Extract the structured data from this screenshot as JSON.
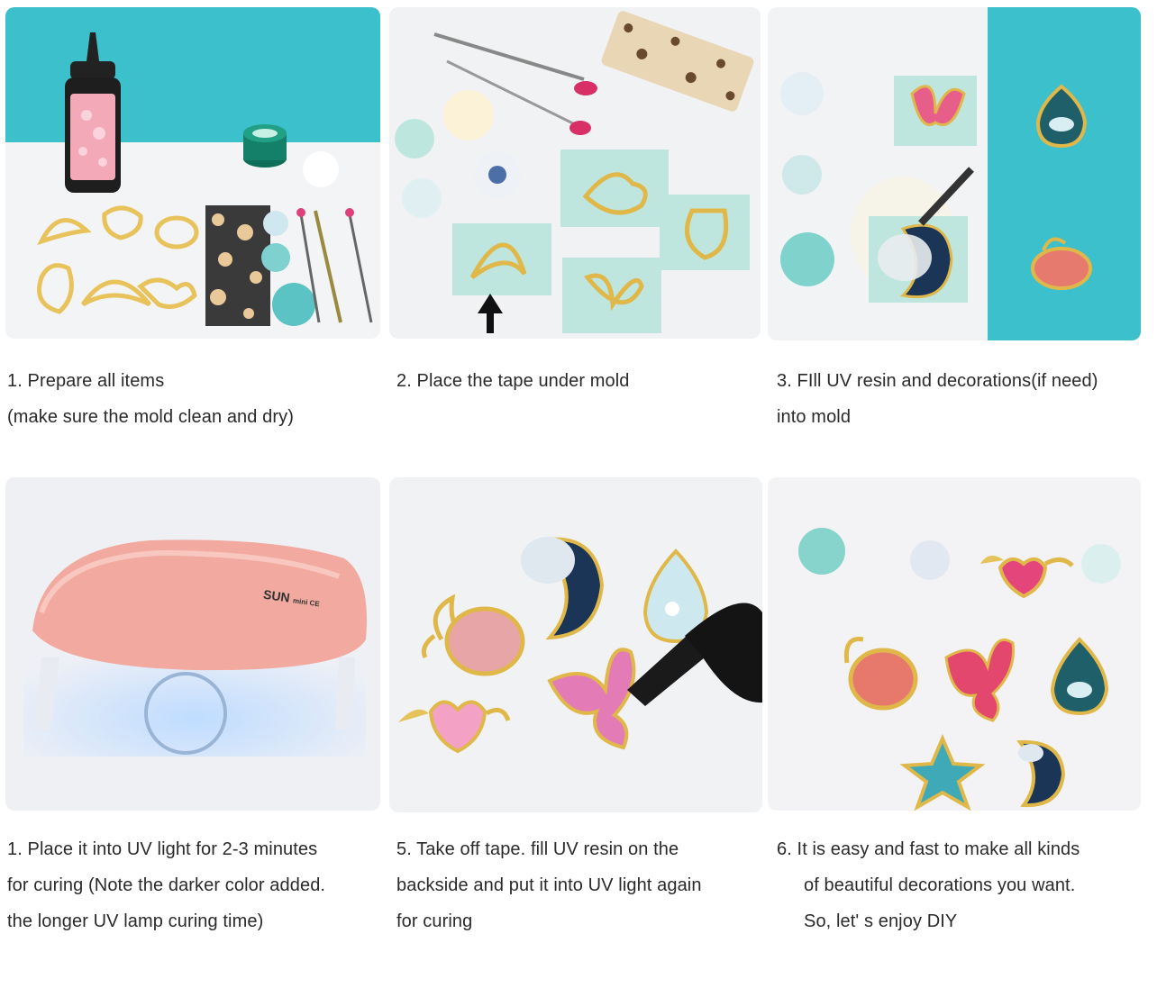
{
  "steps": [
    {
      "lines": [
        "1. Prepare all items",
        "(make sure the mold clean and dry)"
      ]
    },
    {
      "lines": [
        "2. Place the tape under mold"
      ]
    },
    {
      "lines": [
        "3. FIll UV resin and decorations(if need)",
        "into mold"
      ]
    },
    {
      "lines": [
        "1. Place it into UV light for 2-3 minutes",
        "for curing (Note the darker color added.",
        "the longer UV lamp curing time)"
      ]
    },
    {
      "lines": [
        "5. Take off tape. fill UV resin on the",
        "backside and put it into UV light again",
        "for curing"
      ]
    },
    {
      "lines": [
        "6. It is easy and fast to make all kinds",
        "of beautiful decorations you want.",
        "So, let' s enjoy DIY"
      ]
    }
  ],
  "lamp": {
    "brand": "SUN",
    "model": "mini CE"
  },
  "colors": {
    "teal": "#3cc0cc",
    "pink_lamp": "#f2aaa0",
    "gold": "#e8c25a",
    "tape": "#bfe6de"
  }
}
